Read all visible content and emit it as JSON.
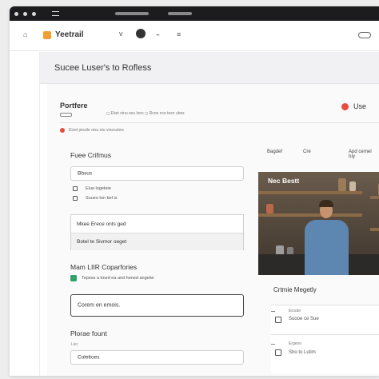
{
  "toolbar": {
    "brand_name": "Yeetrail",
    "chevron": "v",
    "link_icon": "⌁",
    "menu_icon": "≡"
  },
  "page": {
    "title": "Sucee Luser's to Rofless"
  },
  "card": {
    "heading": "Portfere",
    "meta": "◻ Ebet oinu seu lons ◻ Rcne nce tesn ubss",
    "user_label": "Use",
    "alert_text": "Etsel pinsile oisu etu vinesuleis"
  },
  "form": {
    "section_title": "Fuee Crifmus",
    "columns": {
      "c1": "Bagdef",
      "c2": "Cre",
      "c3": "Apd cernel tuy"
    },
    "search_value": "Bbsus",
    "option1_label": "Elue logeteie",
    "option2_label": "Suueo ton bel is",
    "group_rows": [
      "Mkee Erece onts ged",
      "Botel te Sivmor oeget"
    ],
    "section2_title": "Mam LIIR Coparfories",
    "checkbox_label": "Tepess a bned ea and hened angetei",
    "cta_text": "Corem en emois.",
    "section3_title": "Plorae fount",
    "field3_caption": "Lier",
    "field3_value": "Colettoes"
  },
  "hero": {
    "caption": "Nec Bestt"
  },
  "list": {
    "title": "Crtmie Megetly",
    "items": [
      {
        "label": "Eicsde",
        "value": "Suooe ce Sue"
      },
      {
        "label": "Ergeon",
        "value": "Sho to Lutim"
      }
    ]
  },
  "colors": {
    "accent": "#e74c3c",
    "brand": "#f0a030",
    "success": "#2fa36b"
  }
}
